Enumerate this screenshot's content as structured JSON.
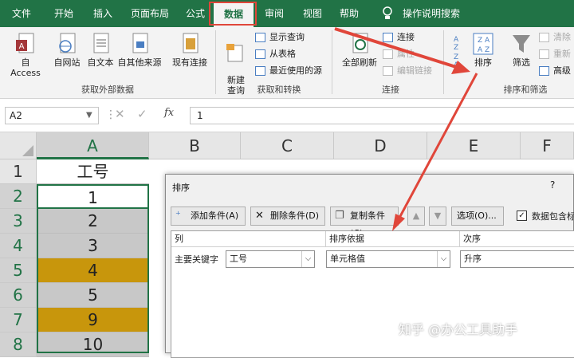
{
  "tabs": [
    "文件",
    "开始",
    "插入",
    "页面布局",
    "公式",
    "数据",
    "审阅",
    "视图",
    "帮助",
    "操作说明搜索"
  ],
  "active_tab": "数据",
  "ribbon": {
    "get_external": {
      "label": "获取外部数据",
      "buttons": [
        "自 Access",
        "自网站",
        "自文本",
        "自其他来源",
        "现有连接"
      ]
    },
    "get_transform": {
      "label": "获取和转换",
      "new_query": "新建\n查询",
      "items": [
        "显示查询",
        "从表格",
        "最近使用的源"
      ]
    },
    "connections": {
      "label": "连接",
      "refresh_all": "全部刷新",
      "items": [
        "连接",
        "属性",
        "编辑链接"
      ]
    },
    "sort_filter": {
      "label": "排序和筛选",
      "sort": "排序",
      "filter": "筛选",
      "items": [
        "清除",
        "重新",
        "高级"
      ]
    }
  },
  "formula_bar": {
    "name_box": "A2",
    "fx": "fx",
    "value": "1"
  },
  "sheet": {
    "columns": [
      "A",
      "B",
      "C",
      "D",
      "E",
      "F"
    ],
    "rows": [
      "1",
      "2",
      "3",
      "4",
      "5",
      "6",
      "7",
      "8"
    ],
    "col_a": [
      "工号",
      "1",
      "2",
      "3",
      "4",
      "5",
      "9",
      "10"
    ]
  },
  "dialog": {
    "title": "排序",
    "help": "?",
    "buttons": {
      "add": "添加条件(A)",
      "delete": "删除条件(D)",
      "copy": "复制条件(C)",
      "options": "选项(O)...",
      "has_header": "数据包含标"
    },
    "headers": {
      "column": "列",
      "sort_on": "排序依据",
      "order": "次序"
    },
    "row": {
      "label": "主要关键字",
      "column": "工号",
      "sort_on": "单元格值",
      "order": "升序"
    }
  },
  "watermark": "知乎 @办公工具助手",
  "colors": {
    "excel_green": "#217346",
    "highlight_red": "#e0463a",
    "gold": "#c8960c",
    "gray_fill": "#c8c8c8"
  }
}
